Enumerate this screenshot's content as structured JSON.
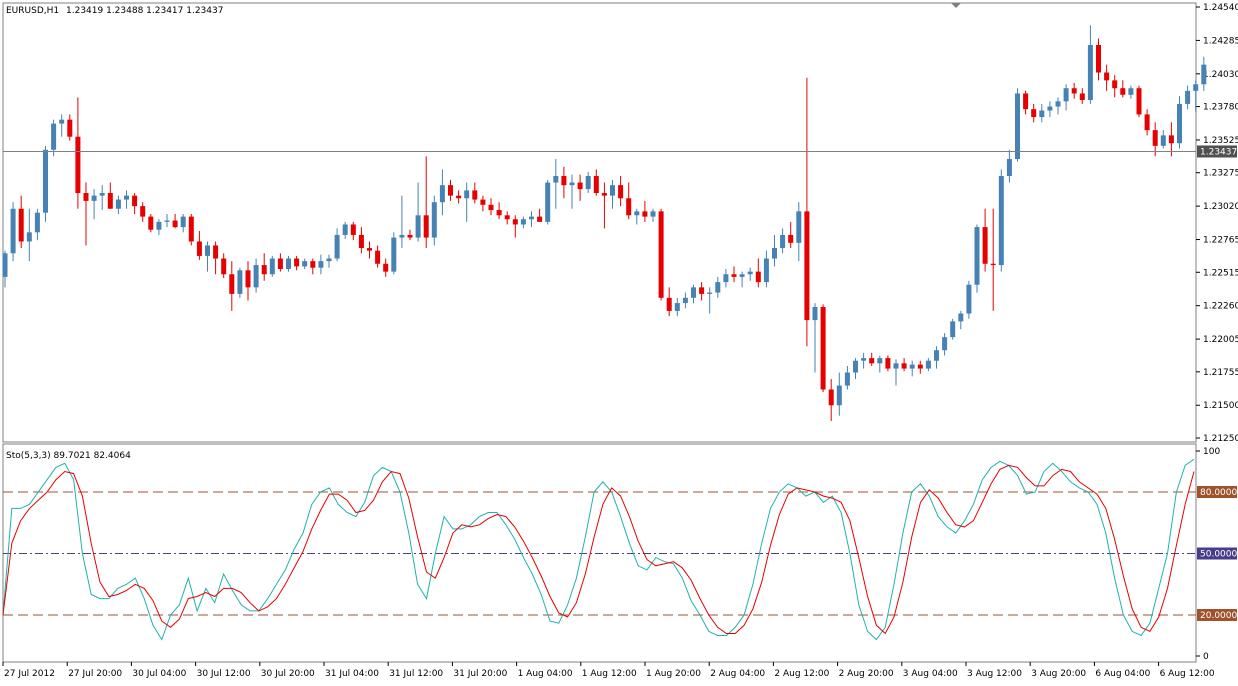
{
  "header": {
    "symbol_label": "EURUSD,H1",
    "ohlc_label": "1.23419 1.23488 1.23417 1.23437"
  },
  "indicator": {
    "label": "Sto(5,3,3) 89.7021 82.4064"
  },
  "colors": {
    "bull": "#4682b4",
    "bear": "#e60000",
    "main_line": "#20b2aa",
    "signal_line": "#e60000",
    "level_line": "#a0522d",
    "mid_line": "#483d8b",
    "bid_line": "#808080",
    "frame": "#808080"
  },
  "chart_data": [
    {
      "type": "candlestick",
      "title": "EURUSD,H1",
      "ylim": [
        1.2125,
        1.2454
      ],
      "y_ticks": [
        "1.24540",
        "1.24285",
        "1.24030",
        "1.23780",
        "1.23525",
        "1.23275",
        "1.23020",
        "1.22765",
        "1.22515",
        "1.22260",
        "1.22005",
        "1.21755",
        "1.21500",
        "1.21250"
      ],
      "current_price": "1.23437",
      "x_ticks": [
        "27 Jul 2012",
        "27 Jul 20:00",
        "30 Jul 04:00",
        "30 Jul 12:00",
        "30 Jul 20:00",
        "31 Jul 04:00",
        "31 Jul 12:00",
        "31 Jul 20:00",
        "1 Aug 04:00",
        "1 Aug 12:00",
        "1 Aug 20:00",
        "2 Aug 04:00",
        "2 Aug 12:00",
        "2 Aug 20:00",
        "3 Aug 04:00",
        "3 Aug 12:00",
        "3 Aug 20:00",
        "6 Aug 04:00",
        "6 Aug 12:00"
      ],
      "ohlc": [
        [
          1.2248,
          1.2268,
          1.224,
          1.2266
        ],
        [
          1.2266,
          1.2305,
          1.226,
          1.23
        ],
        [
          1.23,
          1.231,
          1.227,
          1.2275
        ],
        [
          1.2275,
          1.23,
          1.226,
          1.2282
        ],
        [
          1.2282,
          1.23,
          1.2276,
          1.2297
        ],
        [
          1.2297,
          1.2348,
          1.229,
          1.2345
        ],
        [
          1.2345,
          1.2368,
          1.234,
          1.2365
        ],
        [
          1.2365,
          1.2372,
          1.2355,
          1.2368
        ],
        [
          1.2368,
          1.2372,
          1.2352,
          1.2355
        ],
        [
          1.2355,
          1.2385,
          1.23,
          1.2312
        ],
        [
          1.2312,
          1.232,
          1.2272,
          1.2306
        ],
        [
          1.2306,
          1.2315,
          1.2292,
          1.231
        ],
        [
          1.231,
          1.2318,
          1.2299,
          1.2312
        ],
        [
          1.2312,
          1.232,
          1.23,
          1.23
        ],
        [
          1.23,
          1.231,
          1.2296,
          1.2307
        ],
        [
          1.2307,
          1.2314,
          1.23,
          1.231
        ],
        [
          1.231,
          1.2312,
          1.2296,
          1.2302
        ],
        [
          1.2302,
          1.2305,
          1.229,
          1.2294
        ],
        [
          1.2294,
          1.2296,
          1.2282,
          1.2284
        ],
        [
          1.2284,
          1.2292,
          1.228,
          1.229
        ],
        [
          1.229,
          1.2296,
          1.2286,
          1.2291
        ],
        [
          1.2291,
          1.2296,
          1.2285,
          1.2286
        ],
        [
          1.2286,
          1.2296,
          1.2282,
          1.2294
        ],
        [
          1.2294,
          1.2296,
          1.2272,
          1.2275
        ],
        [
          1.2275,
          1.2283,
          1.2261,
          1.2264
        ],
        [
          1.2264,
          1.2275,
          1.2252,
          1.2272
        ],
        [
          1.2272,
          1.2275,
          1.225,
          1.2262
        ],
        [
          1.2262,
          1.2266,
          1.2247,
          1.225
        ],
        [
          1.225,
          1.226,
          1.2222,
          1.2235
        ],
        [
          1.2235,
          1.2255,
          1.2232,
          1.2253
        ],
        [
          1.2253,
          1.226,
          1.223,
          1.224
        ],
        [
          1.224,
          1.2262,
          1.2236,
          1.2257
        ],
        [
          1.2257,
          1.2266,
          1.2245,
          1.225
        ],
        [
          1.225,
          1.2264,
          1.2248,
          1.2262
        ],
        [
          1.2262,
          1.2266,
          1.2252,
          1.2254
        ],
        [
          1.2254,
          1.2264,
          1.2252,
          1.2262
        ],
        [
          1.2262,
          1.2264,
          1.2253,
          1.2256
        ],
        [
          1.2256,
          1.2262,
          1.2254,
          1.226
        ],
        [
          1.226,
          1.2262,
          1.225,
          1.2255
        ],
        [
          1.2255,
          1.2265,
          1.225,
          1.226
        ],
        [
          1.226,
          1.2265,
          1.2255,
          1.2262
        ],
        [
          1.2262,
          1.2285,
          1.226,
          1.228
        ],
        [
          1.228,
          1.229,
          1.2277,
          1.2288
        ],
        [
          1.2288,
          1.229,
          1.2276,
          1.228
        ],
        [
          1.228,
          1.2286,
          1.2266,
          1.227
        ],
        [
          1.227,
          1.2275,
          1.2262,
          1.2268
        ],
        [
          1.2268,
          1.2272,
          1.2255,
          1.2258
        ],
        [
          1.2258,
          1.2262,
          1.2248,
          1.2252
        ],
        [
          1.2252,
          1.2282,
          1.225,
          1.2278
        ],
        [
          1.2278,
          1.231,
          1.227,
          1.228
        ],
        [
          1.228,
          1.2284,
          1.2276,
          1.2278
        ],
        [
          1.2278,
          1.232,
          1.2275,
          1.2295
        ],
        [
          1.2295,
          1.234,
          1.227,
          1.2278
        ],
        [
          1.2278,
          1.231,
          1.2272,
          1.2305
        ],
        [
          1.2305,
          1.233,
          1.2295,
          1.2318
        ],
        [
          1.2318,
          1.2322,
          1.2306,
          1.231
        ],
        [
          1.231,
          1.2314,
          1.2304,
          1.2308
        ],
        [
          1.2308,
          1.232,
          1.229,
          1.2314
        ],
        [
          1.2314,
          1.232,
          1.2304,
          1.2307
        ],
        [
          1.2307,
          1.231,
          1.2298,
          1.2303
        ],
        [
          1.2303,
          1.2308,
          1.2295,
          1.2299
        ],
        [
          1.2299,
          1.2305,
          1.2292,
          1.2295
        ],
        [
          1.2295,
          1.2298,
          1.2288,
          1.2292
        ],
        [
          1.2292,
          1.2295,
          1.2278,
          1.2288
        ],
        [
          1.2288,
          1.2294,
          1.2285,
          1.2292
        ],
        [
          1.2292,
          1.2298,
          1.2286,
          1.2294
        ],
        [
          1.2294,
          1.23,
          1.229,
          1.229
        ],
        [
          1.229,
          1.2322,
          1.2288,
          1.232
        ],
        [
          1.232,
          1.2338,
          1.23,
          1.2325
        ],
        [
          1.2325,
          1.2332,
          1.2308,
          1.2318
        ],
        [
          1.2318,
          1.2326,
          1.23,
          1.232
        ],
        [
          1.232,
          1.2326,
          1.2306,
          1.2315
        ],
        [
          1.2315,
          1.2328,
          1.2312,
          1.2325
        ],
        [
          1.2325,
          1.233,
          1.231,
          1.2312
        ],
        [
          1.2312,
          1.232,
          1.2285,
          1.231
        ],
        [
          1.231,
          1.2322,
          1.23,
          1.2318
        ],
        [
          1.2318,
          1.2325,
          1.2302,
          1.2308
        ],
        [
          1.2308,
          1.232,
          1.2292,
          1.2295
        ],
        [
          1.2295,
          1.23,
          1.2288,
          1.2298
        ],
        [
          1.2298,
          1.2306,
          1.229,
          1.2294
        ],
        [
          1.2294,
          1.23,
          1.229,
          1.2298
        ],
        [
          1.2298,
          1.23,
          1.223,
          1.2232
        ],
        [
          1.2232,
          1.224,
          1.2218,
          1.2222
        ],
        [
          1.2222,
          1.2232,
          1.2218,
          1.2228
        ],
        [
          1.2228,
          1.2236,
          1.2224,
          1.2232
        ],
        [
          1.2232,
          1.2242,
          1.2228,
          1.224
        ],
        [
          1.224,
          1.2244,
          1.223,
          1.2235
        ],
        [
          1.2235,
          1.224,
          1.222,
          1.2236
        ],
        [
          1.2236,
          1.2248,
          1.2232,
          1.2244
        ],
        [
          1.2244,
          1.2254,
          1.224,
          1.225
        ],
        [
          1.225,
          1.2256,
          1.2244,
          1.2248
        ],
        [
          1.2248,
          1.2252,
          1.224,
          1.225
        ],
        [
          1.225,
          1.2255,
          1.2245,
          1.2252
        ],
        [
          1.2252,
          1.2262,
          1.224,
          1.2244
        ],
        [
          1.2244,
          1.2268,
          1.224,
          1.2262
        ],
        [
          1.2262,
          1.228,
          1.2256,
          1.227
        ],
        [
          1.227,
          1.2285,
          1.2266,
          1.228
        ],
        [
          1.228,
          1.229,
          1.227,
          1.2274
        ],
        [
          1.2274,
          1.2305,
          1.226,
          1.2298
        ],
        [
          1.2298,
          1.24,
          1.2195,
          1.2215
        ],
        [
          1.2215,
          1.2228,
          1.2175,
          1.2225
        ],
        [
          1.2225,
          1.2227,
          1.216,
          1.2162
        ],
        [
          1.2162,
          1.217,
          1.2138,
          1.215
        ],
        [
          1.215,
          1.2175,
          1.2142,
          1.2165
        ],
        [
          1.2165,
          1.218,
          1.2162,
          1.2175
        ],
        [
          1.2175,
          1.2186,
          1.217,
          1.2184
        ],
        [
          1.2184,
          1.219,
          1.2178,
          1.2186
        ],
        [
          1.2186,
          1.219,
          1.218,
          1.2182
        ],
        [
          1.2182,
          1.2188,
          1.2175,
          1.2186
        ],
        [
          1.2186,
          1.2188,
          1.2176,
          1.2178
        ],
        [
          1.2178,
          1.2185,
          1.2165,
          1.2182
        ],
        [
          1.2182,
          1.2186,
          1.2176,
          1.2178
        ],
        [
          1.2178,
          1.2184,
          1.2172,
          1.2181
        ],
        [
          1.2181,
          1.2184,
          1.2174,
          1.2178
        ],
        [
          1.2178,
          1.2186,
          1.2176,
          1.2184
        ],
        [
          1.2184,
          1.2195,
          1.2178,
          1.2192
        ],
        [
          1.2192,
          1.2205,
          1.2188,
          1.2202
        ],
        [
          1.2202,
          1.2216,
          1.22,
          1.2214
        ],
        [
          1.2214,
          1.2222,
          1.2208,
          1.222
        ],
        [
          1.222,
          1.2245,
          1.2216,
          1.2242
        ],
        [
          1.2242,
          1.2288,
          1.2236,
          1.2286
        ],
        [
          1.2286,
          1.23,
          1.2252,
          1.2258
        ],
        [
          1.2258,
          1.23,
          1.2222,
          1.2257
        ],
        [
          1.2257,
          1.233,
          1.2252,
          1.2325
        ],
        [
          1.2325,
          1.2345,
          1.232,
          1.2338
        ],
        [
          1.2338,
          1.2392,
          1.2336,
          1.2388
        ],
        [
          1.2388,
          1.239,
          1.2372,
          1.2376
        ],
        [
          1.2376,
          1.238,
          1.2366,
          1.237
        ],
        [
          1.237,
          1.238,
          1.2366,
          1.2375
        ],
        [
          1.2375,
          1.2382,
          1.237,
          1.2378
        ],
        [
          1.2378,
          1.2385,
          1.2372,
          1.2382
        ],
        [
          1.2382,
          1.2395,
          1.2375,
          1.2392
        ],
        [
          1.2392,
          1.2396,
          1.2384,
          1.2388
        ],
        [
          1.2388,
          1.2392,
          1.238,
          1.2383
        ],
        [
          1.2383,
          1.244,
          1.238,
          1.2425
        ],
        [
          1.2425,
          1.243,
          1.2398,
          1.2404
        ],
        [
          1.2404,
          1.241,
          1.239,
          1.2398
        ],
        [
          1.2398,
          1.2402,
          1.2385,
          1.2392
        ],
        [
          1.2392,
          1.2398,
          1.2385,
          1.2387
        ],
        [
          1.2387,
          1.2394,
          1.2384,
          1.2392
        ],
        [
          1.2392,
          1.2394,
          1.237,
          1.2372
        ],
        [
          1.2372,
          1.2376,
          1.2356,
          1.236
        ],
        [
          1.236,
          1.2366,
          1.234,
          1.2348
        ],
        [
          1.2348,
          1.236,
          1.2346,
          1.2356
        ],
        [
          1.2356,
          1.2366,
          1.234,
          1.235
        ],
        [
          1.235,
          1.2386,
          1.2346,
          1.238
        ],
        [
          1.238,
          1.2394,
          1.2376,
          1.239
        ],
        [
          1.239,
          1.2398,
          1.2374,
          1.2395
        ],
        [
          1.2395,
          1.2416,
          1.239,
          1.241
        ]
      ]
    },
    {
      "type": "line",
      "title": "Sto(5,3,3) 89.7021 82.4064",
      "ylim": [
        0,
        100
      ],
      "y_ticks": [
        "100",
        "0"
      ],
      "levels": [
        "80.00000",
        "50.00000",
        "20.00000"
      ],
      "series": [
        {
          "name": "main",
          "values": [
            20,
            72,
            72,
            74,
            80,
            86,
            92,
            94,
            86,
            50,
            30,
            28,
            28,
            33,
            35,
            38,
            28,
            15,
            8,
            20,
            25,
            38,
            22,
            33,
            26,
            40,
            32,
            25,
            22,
            22,
            28,
            35,
            42,
            52,
            60,
            74,
            80,
            82,
            74,
            70,
            68,
            75,
            88,
            92,
            90,
            80,
            60,
            35,
            28,
            50,
            68,
            62,
            62,
            64,
            68,
            70,
            70,
            64,
            57,
            48,
            40,
            30,
            17,
            16,
            25,
            38,
            58,
            80,
            85,
            80,
            68,
            55,
            44,
            42,
            48,
            46,
            45,
            38,
            27,
            20,
            12,
            10,
            10,
            14,
            20,
            35,
            55,
            72,
            80,
            84,
            82,
            78,
            80,
            75,
            78,
            70,
            50,
            25,
            12,
            8,
            14,
            35,
            60,
            80,
            84,
            78,
            68,
            63,
            60,
            66,
            74,
            86,
            92,
            95,
            93,
            88,
            79,
            80,
            90,
            94,
            90,
            85,
            82,
            80,
            74,
            60,
            38,
            20,
            12,
            10,
            16,
            33,
            50,
            80,
            93,
            96
          ]
        },
        {
          "name": "signal",
          "values": [
            20,
            55,
            66,
            72,
            76,
            80,
            86,
            90,
            89,
            78,
            55,
            36,
            29,
            30,
            32,
            35,
            33,
            27,
            17,
            14,
            18,
            28,
            29,
            31,
            29,
            33,
            33,
            31,
            26,
            22,
            24,
            28,
            35,
            43,
            51,
            62,
            71,
            79,
            79,
            76,
            70,
            71,
            76,
            85,
            90,
            89,
            77,
            58,
            41,
            38,
            48,
            60,
            64,
            63,
            64,
            67,
            69,
            68,
            63,
            56,
            48,
            39,
            29,
            21,
            19,
            26,
            40,
            58,
            74,
            82,
            78,
            68,
            56,
            47,
            44,
            45,
            46,
            43,
            37,
            28,
            20,
            14,
            11,
            11,
            15,
            23,
            36,
            54,
            69,
            79,
            82,
            81,
            80,
            78,
            77,
            75,
            66,
            48,
            29,
            15,
            11,
            19,
            36,
            58,
            75,
            81,
            77,
            70,
            64,
            63,
            66,
            75,
            84,
            91,
            93,
            92,
            87,
            83,
            83,
            88,
            91,
            90,
            85,
            82,
            79,
            72,
            57,
            39,
            23,
            14,
            12,
            19,
            33,
            54,
            74,
            90
          ]
        }
      ]
    }
  ]
}
